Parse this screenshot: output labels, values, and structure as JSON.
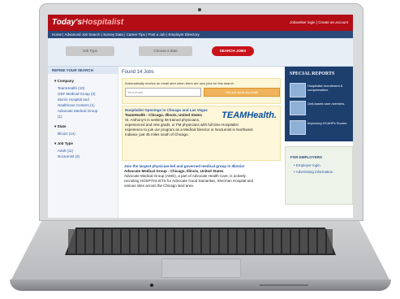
{
  "header": {
    "logo_main": "Today's",
    "logo_sub": "Hospitalist",
    "jobseeker_login": "Jobseeker login",
    "create_account": "Create an account",
    "separator": "|"
  },
  "nav": {
    "items": [
      "Home",
      "Advanced Job Search",
      "Survey Data",
      "Career Tips",
      "Post a Job",
      "Employer Directory"
    ]
  },
  "search": {
    "job_type": "Job Type",
    "date": "Choose a date",
    "button": "SEARCH JOBS"
  },
  "sidebar": {
    "title": "REFINE YOUR SEARCH",
    "company_heading": "Company",
    "companies": [
      "TeamHealth (10)",
      "OSF Medical Group (2)",
      "Morris Hospital and",
      "Healthcare Centers (1)",
      "Advocate Medical Group",
      "(1)"
    ],
    "state_heading": "State",
    "states": [
      "Illinois (14)"
    ],
    "jobtype_heading": "Job Type",
    "jobtypes": [
      "Adult (11)",
      "Nocturnist (3)"
    ]
  },
  "main": {
    "found": "Found 14 Jobs",
    "alert_text": "Automatically receive an email alert when there are new jobs for this search",
    "email_placeholder": "Your email",
    "subscribe": "Get job alerts by email",
    "job1": {
      "link": "Hospitalist Openings in Chicago and Las Vegas",
      "title": "TeamHealth - Chicago, Illinois, United States",
      "desc": [
        "St. Anthony's is seeking IM trained physicians,",
        "experienced and new grads, or FM physicians with full time Hospitalist",
        "experience to join our program as a Medical Director or Nocturnist in Northwest",
        "Indiana- just 45 miles south of Chicago."
      ],
      "brand": "TEAMHealth."
    },
    "job2": {
      "link": "Join the largest physician-led and governed medical group in Illinois!",
      "title": "Advocate Medical Group - Chicago, Illinois, United States",
      "desc": [
        "Advocate Medical Group (AMG), a part of Advocate Health Care, is actively",
        "recruiting HOSPITALISTS for Advocate Good Samaritan, Sherman Hospital and",
        "various sites across the Chicago land area."
      ]
    }
  },
  "right": {
    "special_title": "SPECIAL REPORTS",
    "reports": [
      "Hospitalist recruitment & compensation.",
      "Unit-based care overview.",
      "Improving HCAHPs Scores."
    ],
    "employers_title": "FOR EMPLOYERS",
    "employer_links": [
      "Employer login",
      "Advertising information"
    ]
  },
  "colors": {
    "brand_red": "#b30d16",
    "nav_blue": "#2b4a7a",
    "link_blue": "#2957a6"
  }
}
